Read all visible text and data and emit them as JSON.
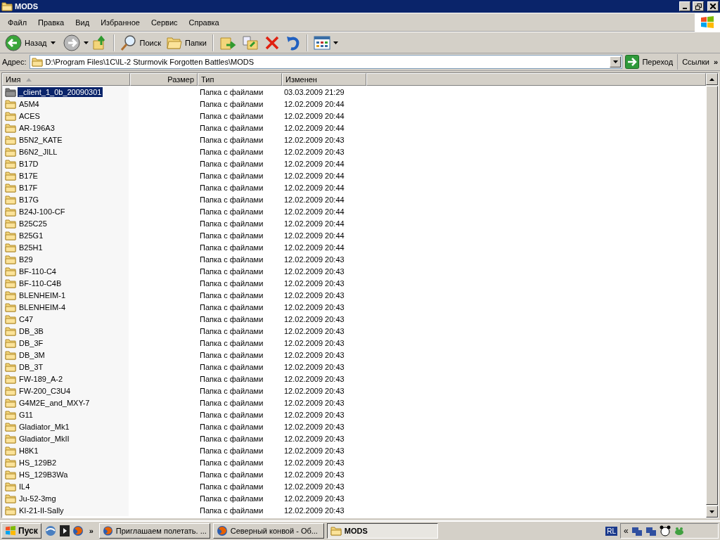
{
  "window": {
    "title": "MODS"
  },
  "menu": [
    "Файл",
    "Правка",
    "Вид",
    "Избранное",
    "Сервис",
    "Справка"
  ],
  "toolbar": {
    "back": "Назад",
    "search": "Поиск",
    "folders": "Папки"
  },
  "address": {
    "label": "Адрес:",
    "value": "D:\\Program Files\\1C\\IL-2 Sturmovik Forgotten Battles\\MODS",
    "go": "Переход",
    "links": "Ссылки",
    "more": "»"
  },
  "table": {
    "columns": [
      {
        "label": "Имя",
        "sorted": true
      },
      {
        "label": "Размер",
        "sorted": false
      },
      {
        "label": "Тип",
        "sorted": false
      },
      {
        "label": "Изменен",
        "sorted": false
      }
    ],
    "rows": [
      {
        "name": "_client_1_0b_20090301",
        "type": "Папка с файлами",
        "modified": "03.03.2009 21:29",
        "selected": true
      },
      {
        "name": "A5M4",
        "type": "Папка с файлами",
        "modified": "12.02.2009 20:44",
        "selected": false
      },
      {
        "name": "ACES",
        "type": "Папка с файлами",
        "modified": "12.02.2009 20:44",
        "selected": false
      },
      {
        "name": "AR-196A3",
        "type": "Папка с файлами",
        "modified": "12.02.2009 20:44",
        "selected": false
      },
      {
        "name": "B5N2_KATE",
        "type": "Папка с файлами",
        "modified": "12.02.2009 20:43",
        "selected": false
      },
      {
        "name": "B6N2_JILL",
        "type": "Папка с файлами",
        "modified": "12.02.2009 20:43",
        "selected": false
      },
      {
        "name": "B17D",
        "type": "Папка с файлами",
        "modified": "12.02.2009 20:44",
        "selected": false
      },
      {
        "name": "B17E",
        "type": "Папка с файлами",
        "modified": "12.02.2009 20:44",
        "selected": false
      },
      {
        "name": "B17F",
        "type": "Папка с файлами",
        "modified": "12.02.2009 20:44",
        "selected": false
      },
      {
        "name": "B17G",
        "type": "Папка с файлами",
        "modified": "12.02.2009 20:44",
        "selected": false
      },
      {
        "name": "B24J-100-CF",
        "type": "Папка с файлами",
        "modified": "12.02.2009 20:44",
        "selected": false
      },
      {
        "name": "B25C25",
        "type": "Папка с файлами",
        "modified": "12.02.2009 20:44",
        "selected": false
      },
      {
        "name": "B25G1",
        "type": "Папка с файлами",
        "modified": "12.02.2009 20:44",
        "selected": false
      },
      {
        "name": "B25H1",
        "type": "Папка с файлами",
        "modified": "12.02.2009 20:44",
        "selected": false
      },
      {
        "name": "B29",
        "type": "Папка с файлами",
        "modified": "12.02.2009 20:43",
        "selected": false
      },
      {
        "name": "BF-110-C4",
        "type": "Папка с файлами",
        "modified": "12.02.2009 20:43",
        "selected": false
      },
      {
        "name": "BF-110-C4B",
        "type": "Папка с файлами",
        "modified": "12.02.2009 20:43",
        "selected": false
      },
      {
        "name": "BLENHEIM-1",
        "type": "Папка с файлами",
        "modified": "12.02.2009 20:43",
        "selected": false
      },
      {
        "name": "BLENHEIM-4",
        "type": "Папка с файлами",
        "modified": "12.02.2009 20:43",
        "selected": false
      },
      {
        "name": "C47",
        "type": "Папка с файлами",
        "modified": "12.02.2009 20:43",
        "selected": false
      },
      {
        "name": "DB_3B",
        "type": "Папка с файлами",
        "modified": "12.02.2009 20:43",
        "selected": false
      },
      {
        "name": "DB_3F",
        "type": "Папка с файлами",
        "modified": "12.02.2009 20:43",
        "selected": false
      },
      {
        "name": "DB_3M",
        "type": "Папка с файлами",
        "modified": "12.02.2009 20:43",
        "selected": false
      },
      {
        "name": "DB_3T",
        "type": "Папка с файлами",
        "modified": "12.02.2009 20:43",
        "selected": false
      },
      {
        "name": "FW-189_A-2",
        "type": "Папка с файлами",
        "modified": "12.02.2009 20:43",
        "selected": false
      },
      {
        "name": "FW-200_C3U4",
        "type": "Папка с файлами",
        "modified": "12.02.2009 20:43",
        "selected": false
      },
      {
        "name": "G4M2E_and_MXY-7",
        "type": "Папка с файлами",
        "modified": "12.02.2009 20:43",
        "selected": false
      },
      {
        "name": "G11",
        "type": "Папка с файлами",
        "modified": "12.02.2009 20:43",
        "selected": false
      },
      {
        "name": "Gladiator_Mk1",
        "type": "Папка с файлами",
        "modified": "12.02.2009 20:43",
        "selected": false
      },
      {
        "name": "Gladiator_MkII",
        "type": "Папка с файлами",
        "modified": "12.02.2009 20:43",
        "selected": false
      },
      {
        "name": "H8K1",
        "type": "Папка с файлами",
        "modified": "12.02.2009 20:43",
        "selected": false
      },
      {
        "name": "HS_129B2",
        "type": "Папка с файлами",
        "modified": "12.02.2009 20:43",
        "selected": false
      },
      {
        "name": "HS_129B3Wa",
        "type": "Папка с файлами",
        "modified": "12.02.2009 20:43",
        "selected": false
      },
      {
        "name": "IL4",
        "type": "Папка с файлами",
        "modified": "12.02.2009 20:43",
        "selected": false
      },
      {
        "name": "Ju-52-3mg",
        "type": "Папка с файлами",
        "modified": "12.02.2009 20:43",
        "selected": false
      },
      {
        "name": "KI-21-II-Sally",
        "type": "Папка с файлами",
        "modified": "12.02.2009 20:43",
        "selected": false
      }
    ]
  },
  "taskbar": {
    "start": "Пуск",
    "more": "»",
    "tasks": [
      {
        "label": "Приглашаем полетать. ...",
        "kind": "browser",
        "selected": false
      },
      {
        "label": "Северный конвой - Об...",
        "kind": "browser",
        "selected": false
      },
      {
        "label": "MODS",
        "kind": "folder",
        "selected": true
      }
    ],
    "language": "RL",
    "tray_more": "«"
  }
}
